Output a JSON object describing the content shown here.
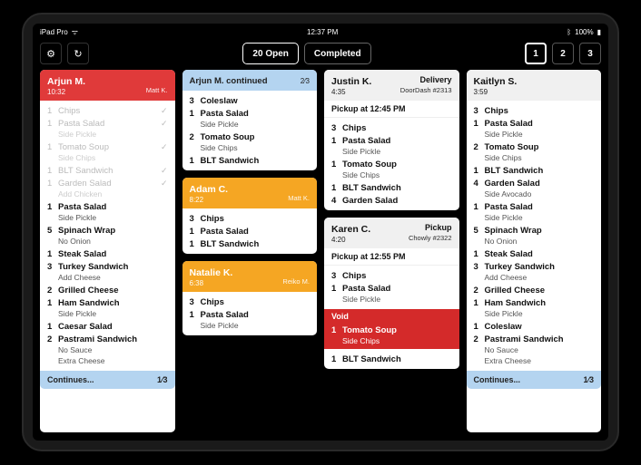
{
  "status": {
    "device": "iPad Pro",
    "time": "12:37 PM",
    "battery": "100%"
  },
  "toolbar": {
    "tabs": {
      "open": "20 Open",
      "completed": "Completed"
    },
    "pages": [
      "1",
      "2",
      "3"
    ]
  },
  "continues_label": "Continues...",
  "tickets": {
    "arjun": {
      "name": "Arjun M.",
      "time": "10:32",
      "server": "Matt K.",
      "items": [
        {
          "qty": "1",
          "name": "Chips",
          "done": true
        },
        {
          "qty": "1",
          "name": "Pasta Salad",
          "done": true,
          "mods": [
            "Side Pickle"
          ]
        },
        {
          "qty": "1",
          "name": "Tomato Soup",
          "done": true,
          "mods": [
            "Side Chips"
          ]
        },
        {
          "qty": "1",
          "name": "BLT Sandwich",
          "done": true
        },
        {
          "qty": "1",
          "name": "Garden Salad",
          "done": true,
          "mods": [
            "Add Chicken"
          ]
        },
        {
          "qty": "1",
          "name": "Pasta Salad",
          "mods": [
            "Side Pickle"
          ]
        },
        {
          "qty": "5",
          "name": "Spinach Wrap",
          "mods": [
            "No Onion"
          ]
        },
        {
          "qty": "1",
          "name": "Steak Salad"
        },
        {
          "qty": "3",
          "name": "Turkey Sandwich",
          "mods": [
            "Add Cheese"
          ]
        },
        {
          "qty": "2",
          "name": "Grilled Cheese"
        },
        {
          "qty": "1",
          "name": "Ham Sandwich",
          "mods": [
            "Side Pickle"
          ]
        },
        {
          "qty": "1",
          "name": "Caesar Salad"
        },
        {
          "qty": "2",
          "name": "Pastrami Sandwich",
          "mods": [
            "No Sauce",
            "Extra Cheese"
          ]
        }
      ],
      "frac": "1⁄3"
    },
    "arjun_cont": {
      "title": "Arjun M. continued",
      "frac": "2⁄3",
      "items": [
        {
          "qty": "3",
          "name": "Coleslaw"
        },
        {
          "qty": "1",
          "name": "Pasta Salad",
          "mods": [
            "Side Pickle"
          ]
        },
        {
          "qty": "2",
          "name": "Tomato Soup",
          "mods": [
            "Side Chips"
          ]
        },
        {
          "qty": "1",
          "name": "BLT Sandwich"
        }
      ]
    },
    "adam": {
      "name": "Adam C.",
      "time": "8:22",
      "server": "Matt K.",
      "items": [
        {
          "qty": "3",
          "name": "Chips"
        },
        {
          "qty": "1",
          "name": "Pasta Salad"
        },
        {
          "qty": "1",
          "name": "BLT Sandwich"
        }
      ]
    },
    "natalie": {
      "name": "Natalie K.",
      "time": "6:38",
      "server": "Reiko M.",
      "items": [
        {
          "qty": "3",
          "name": "Chips"
        },
        {
          "qty": "1",
          "name": "Pasta Salad",
          "mods": [
            "Side Pickle"
          ]
        }
      ]
    },
    "justin": {
      "name": "Justin K.",
      "time": "4:35",
      "tag": "Delivery",
      "provider": "DoorDash #2313",
      "note": "Pickup at 12:45 PM",
      "items": [
        {
          "qty": "3",
          "name": "Chips"
        },
        {
          "qty": "1",
          "name": "Pasta Salad",
          "mods": [
            "Side Pickle"
          ]
        },
        {
          "qty": "1",
          "name": "Tomato Soup",
          "mods": [
            "Side Chips"
          ]
        },
        {
          "qty": "1",
          "name": "BLT Sandwich"
        },
        {
          "qty": "4",
          "name": "Garden Salad"
        }
      ]
    },
    "karen": {
      "name": "Karen C.",
      "time": "4:20",
      "tag": "Pickup",
      "provider": "Chowly #2322",
      "note": "Pickup at 12:55 PM",
      "items": [
        {
          "qty": "3",
          "name": "Chips"
        },
        {
          "qty": "1",
          "name": "Pasta Salad",
          "mods": [
            "Side Pickle"
          ]
        }
      ],
      "void_label": "Void",
      "void_items": [
        {
          "qty": "1",
          "name": "Tomato Soup",
          "mods": [
            "Side Chips"
          ]
        }
      ],
      "after_void": [
        {
          "qty": "1",
          "name": "BLT Sandwich"
        }
      ]
    },
    "kaitlyn": {
      "name": "Kaitlyn S.",
      "time": "3:59",
      "items": [
        {
          "qty": "3",
          "name": "Chips"
        },
        {
          "qty": "1",
          "name": "Pasta Salad",
          "mods": [
            "Side Pickle"
          ]
        },
        {
          "qty": "2",
          "name": "Tomato Soup",
          "mods": [
            "Side Chips"
          ]
        },
        {
          "qty": "1",
          "name": "BLT Sandwich"
        },
        {
          "qty": "4",
          "name": "Garden Salad",
          "mods": [
            "Side Avocado"
          ]
        },
        {
          "qty": "1",
          "name": "Pasta Salad",
          "mods": [
            "Side Pickle"
          ]
        },
        {
          "qty": "5",
          "name": "Spinach Wrap",
          "mods": [
            "No Onion"
          ]
        },
        {
          "qty": "1",
          "name": "Steak Salad"
        },
        {
          "qty": "3",
          "name": "Turkey Sandwich",
          "mods": [
            "Add Cheese"
          ]
        },
        {
          "qty": "2",
          "name": "Grilled Cheese"
        },
        {
          "qty": "1",
          "name": "Ham Sandwich",
          "mods": [
            "Side Pickle"
          ]
        },
        {
          "qty": "1",
          "name": "Coleslaw"
        },
        {
          "qty": "2",
          "name": "Pastrami Sandwich",
          "mods": [
            "No Sauce",
            "Extra Cheese"
          ]
        }
      ],
      "frac": "1⁄3"
    }
  }
}
